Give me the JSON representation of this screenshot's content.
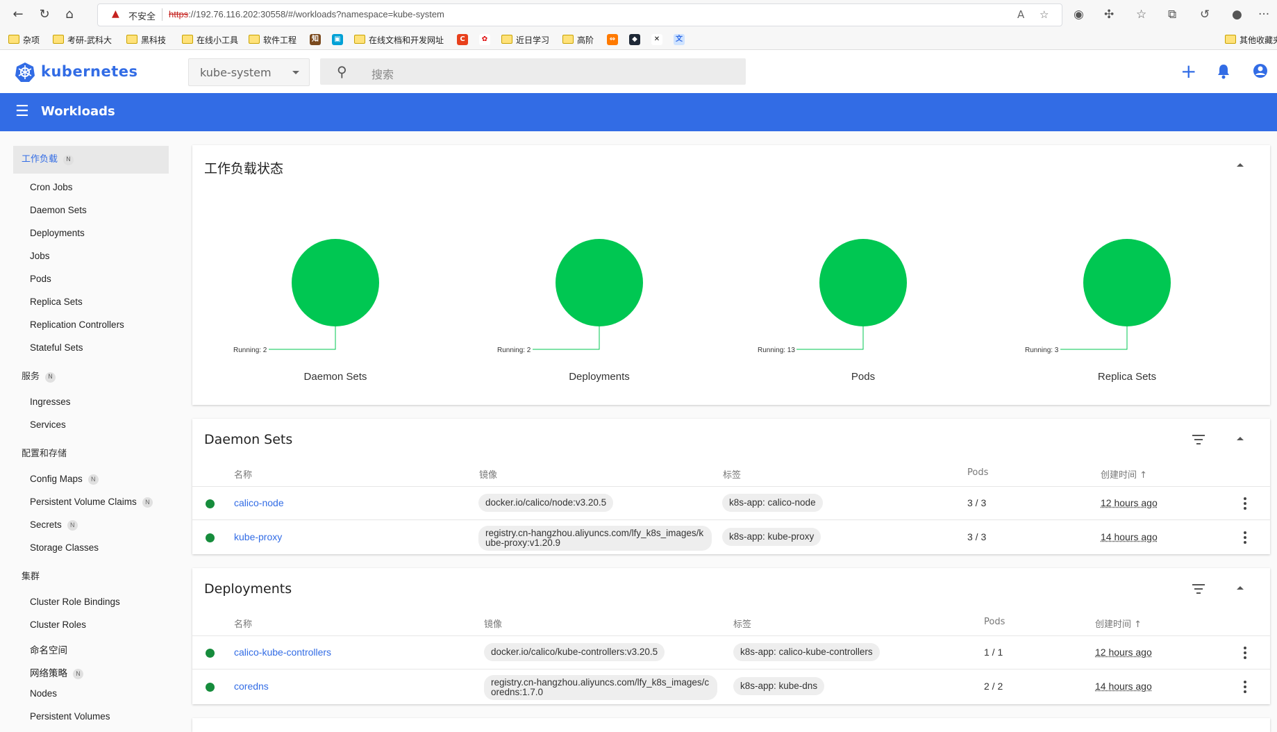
{
  "browser": {
    "insecure_label": "不安全",
    "url_scheme": "https",
    "url_rest": "://192.76.116.202:30558/#/workloads?namespace=kube-system",
    "bookmarks": [
      "杂项",
      "考研-武科大",
      "黑科技",
      "在线小工具",
      "软件工程",
      "在线文档和开发网址",
      "近日学习",
      "高阶"
    ],
    "other_bookmarks": "其他收藏夹"
  },
  "app": {
    "brand": "kubernetes",
    "namespace": "kube-system",
    "search_placeholder": "搜索",
    "toolbar_title": "Workloads"
  },
  "sidebar": {
    "workloads": {
      "label": "工作负载",
      "badge": "N"
    },
    "workload_items": [
      "Cron Jobs",
      "Daemon Sets",
      "Deployments",
      "Jobs",
      "Pods",
      "Replica Sets",
      "Replication Controllers",
      "Stateful Sets"
    ],
    "service": {
      "label": "服务",
      "badge": "N"
    },
    "service_items": [
      "Ingresses",
      "Services"
    ],
    "config": {
      "label": "配置和存储"
    },
    "config_items": [
      {
        "label": "Config Maps",
        "badge": "N"
      },
      {
        "label": "Persistent Volume Claims",
        "badge": "N"
      },
      {
        "label": "Secrets",
        "badge": "N"
      },
      {
        "label": "Storage Classes",
        "badge": ""
      }
    ],
    "cluster": {
      "label": "集群"
    },
    "cluster_items": [
      {
        "label": "Cluster Role Bindings",
        "badge": ""
      },
      {
        "label": "Cluster Roles",
        "badge": ""
      },
      {
        "label": "命名空间",
        "badge": ""
      },
      {
        "label": "网络策略",
        "badge": "N"
      },
      {
        "label": "Nodes",
        "badge": ""
      },
      {
        "label": "Persistent Volumes",
        "badge": ""
      }
    ]
  },
  "status": {
    "title": "工作负载状态",
    "charts": [
      {
        "label": "Daemon Sets",
        "running": "Running: 2",
        "color": "#00c752"
      },
      {
        "label": "Deployments",
        "running": "Running: 2",
        "color": "#00c752"
      },
      {
        "label": "Pods",
        "running": "Running: 13",
        "color": "#00c752"
      },
      {
        "label": "Replica Sets",
        "running": "Running: 3",
        "color": "#00c752"
      }
    ]
  },
  "daemonsets": {
    "title": "Daemon Sets",
    "headers": {
      "name": "名称",
      "image": "镜像",
      "labels": "标签",
      "pods": "Pods",
      "created": "创建时间"
    },
    "rows": [
      {
        "name": "calico-node",
        "image": "docker.io/calico/node:v3.20.5",
        "label": "k8s-app: calico-node",
        "pods": "3 / 3",
        "created": "12 hours ago"
      },
      {
        "name": "kube-proxy",
        "image": "registry.cn-hangzhou.aliyuncs.com/lfy_k8s_images/kube-proxy:v1.20.9",
        "label": "k8s-app: kube-proxy",
        "pods": "3 / 3",
        "created": "14 hours ago"
      }
    ]
  },
  "deployments": {
    "title": "Deployments",
    "headers": {
      "name": "名称",
      "image": "镜像",
      "labels": "标签",
      "pods": "Pods",
      "created": "创建时间"
    },
    "rows": [
      {
        "name": "calico-kube-controllers",
        "image": "docker.io/calico/kube-controllers:v3.20.5",
        "label": "k8s-app: calico-kube-controllers",
        "pods": "1 / 1",
        "created": "12 hours ago"
      },
      {
        "name": "coredns",
        "image": "registry.cn-hangzhou.aliyuncs.com/lfy_k8s_images/coredns:1.7.0",
        "label": "k8s-app: kube-dns",
        "pods": "2 / 2",
        "created": "14 hours ago"
      }
    ]
  },
  "colors": {
    "primary": "#326ce5",
    "running": "#00c752",
    "status_dot": "#168c3c"
  }
}
